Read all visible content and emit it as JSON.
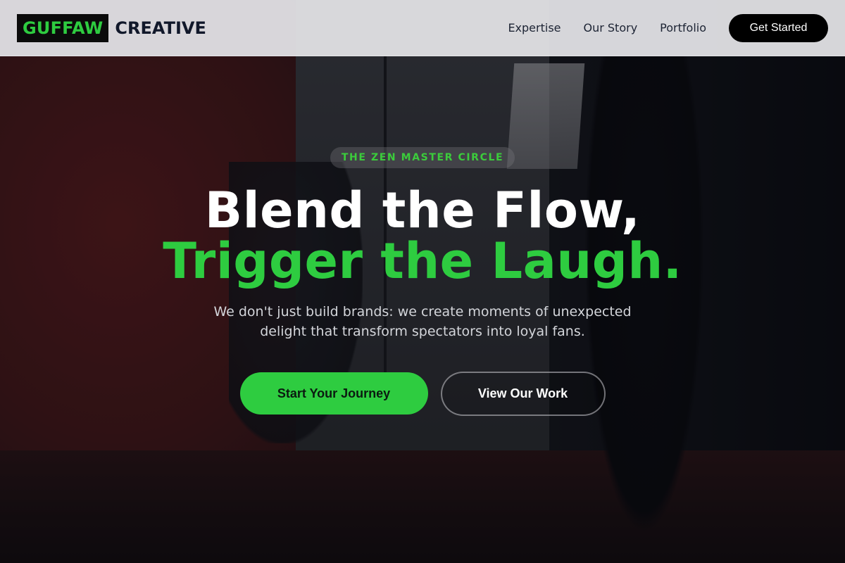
{
  "header": {
    "logo_mark": "GUFFAW",
    "logo_word": "CREATIVE",
    "nav": [
      {
        "label": "Expertise"
      },
      {
        "label": "Our Story"
      },
      {
        "label": "Portfolio"
      }
    ],
    "cta_label": "Get Started"
  },
  "hero": {
    "badge": "THE ZEN MASTER CIRCLE",
    "title_line1": "Blend the Flow,",
    "title_line2": "Trigger the Laugh.",
    "subtitle": "We don't just build brands: we create moments of unexpected delight that transform spectators into loyal fans.",
    "primary_button": "Start Your Journey",
    "secondary_button": "View Our Work"
  },
  "colors": {
    "accent": "#2ecc40",
    "header_bg": "#e1e2e5",
    "cta_bg": "#000000"
  }
}
